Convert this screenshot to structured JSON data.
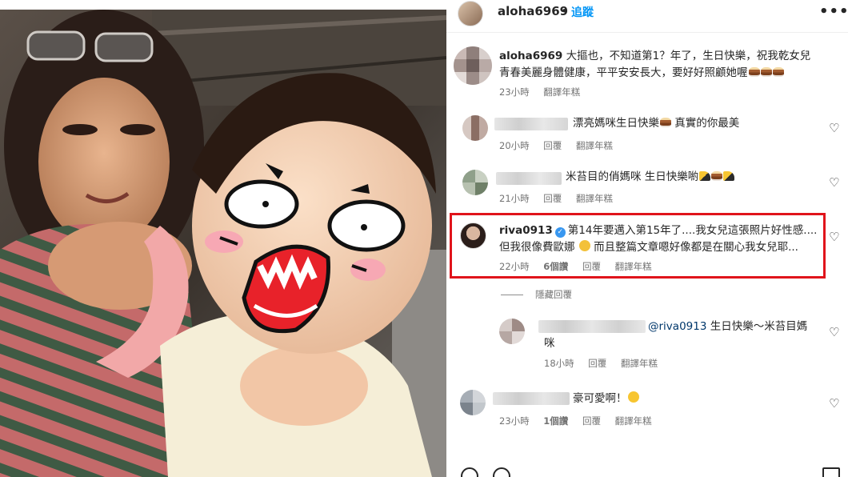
{
  "post": {
    "username": "aloha6969",
    "separator": "•",
    "follow_label": "追蹤",
    "more_label": "•••"
  },
  "icons": {
    "more": "more-options-icon",
    "heart": "heart-outline-icon",
    "verified": "verified-badge-icon",
    "like": "like-icon",
    "comment": "comment-icon",
    "save": "bookmark-icon"
  },
  "caption": {
    "username": "aloha6969",
    "text": "大摳也，不知道第1？年了，生日快樂，祝我乾女兒青春美麗身體健康，平平安安長大，要好好照顧她喔",
    "time": "23小時",
    "translate": "翻譯年糕"
  },
  "comments": [
    {
      "text": "漂亮媽咪生日快樂",
      "text2": "真實的你最美",
      "time": "20小時",
      "reply": "回覆",
      "translate": "翻譯年糕"
    },
    {
      "text": "米苔目的俏媽咪 生日快樂喲",
      "time": "21小時",
      "reply": "回覆",
      "translate": "翻譯年糕"
    },
    {
      "username": "riva0913",
      "line1": "第14年要邁入第15年了....我女兒這張照片好性感....",
      "line2a": "但我很像費歐娜",
      "line2b": "而且整篇文章嗯好像都是在關心我女兒耶...",
      "time": "22小時",
      "likes": "6個讚",
      "reply": "回覆",
      "translate": "翻譯年糕"
    }
  ],
  "hide_replies": "隱藏回覆",
  "reply": {
    "mention": "@riva0913",
    "text": " 生日快樂～米苔目媽",
    "text2": "咪",
    "time": "18小時",
    "reply": "回覆",
    "translate": "翻譯年糕"
  },
  "last_comment": {
    "text": "豪可愛啊！",
    "time": "23小時",
    "likes": "1個讚",
    "reply": "回覆",
    "translate": "翻譯年糕"
  },
  "colors": {
    "link_blue": "#0095f6",
    "highlight_red": "#e0141b",
    "muted": "#737373"
  }
}
